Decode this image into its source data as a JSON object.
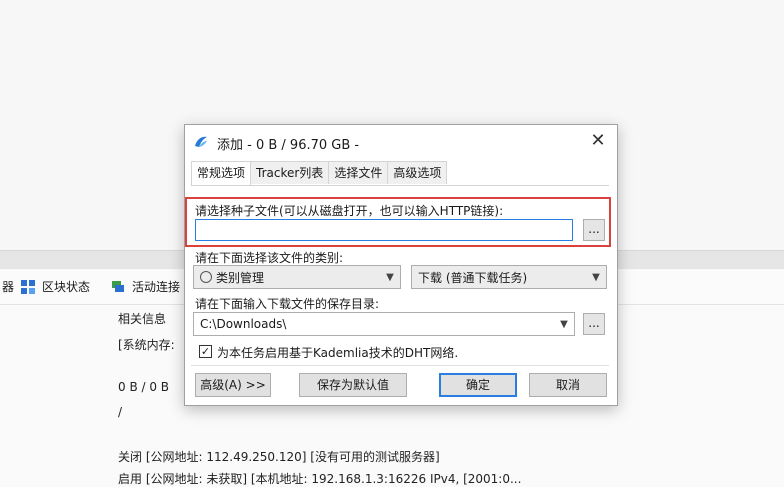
{
  "background": {
    "toolbar": {
      "left_fragment": "器",
      "block_status": "区块状态",
      "active_connections": "活动连接"
    },
    "info": {
      "related_info": "相关信息",
      "sys_memory": "[系统内存:",
      "speed": "0 B / 0 B",
      "slash": "/",
      "log_line1": "关闭 [公网地址: 112.49.250.120] [没有可用的测试服务器]",
      "log_line2": "启用 [公网地址: 未获取] [本机地址: 192.168.1.3:16226 IPv4, [2001:0..."
    }
  },
  "dialog": {
    "title": "添加 - 0 B / 96.70 GB -",
    "tabs": [
      "常规选项",
      "Tracker列表",
      "选择文件",
      "高级选项"
    ],
    "torrent_label": "请选择种子文件(可以从磁盘打开，也可以输入HTTP链接):",
    "torrent_input_value": "",
    "browse_label": "...",
    "category_label": "请在下面选择该文件的类别:",
    "category_value": "类别管理",
    "download_type_value": "下载 (普通下载任务)",
    "save_dir_label": "请在下面输入下载文件的保存目录:",
    "save_dir_value": "C:\\Downloads\\",
    "dht_checkbox_label": "为本任务启用基于Kademlia技术的DHT网络.",
    "dht_checked": "✓",
    "advanced_button": "高级(A) >>",
    "save_default_button": "保存为默认值",
    "ok_button": "确定",
    "cancel_button": "取消",
    "accent_color": "#2a7de1",
    "highlight_color": "#d9433b"
  }
}
